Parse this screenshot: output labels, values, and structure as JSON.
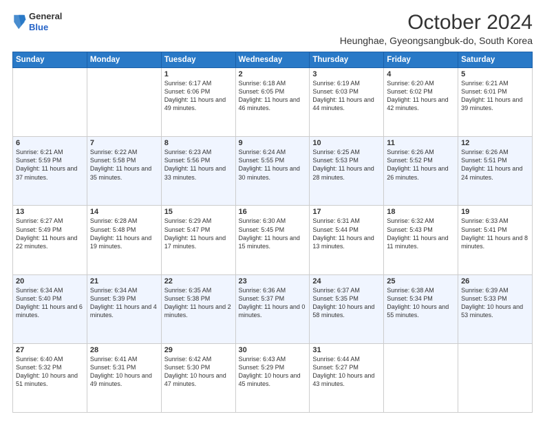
{
  "header": {
    "logo": {
      "line1": "General",
      "line2": "Blue"
    },
    "month": "October 2024",
    "location": "Heunghae, Gyeongsangbuk-do, South Korea"
  },
  "days_of_week": [
    "Sunday",
    "Monday",
    "Tuesday",
    "Wednesday",
    "Thursday",
    "Friday",
    "Saturday"
  ],
  "weeks": [
    [
      {
        "day": "",
        "info": ""
      },
      {
        "day": "",
        "info": ""
      },
      {
        "day": "1",
        "info": "Sunrise: 6:17 AM\nSunset: 6:06 PM\nDaylight: 11 hours and 49 minutes."
      },
      {
        "day": "2",
        "info": "Sunrise: 6:18 AM\nSunset: 6:05 PM\nDaylight: 11 hours and 46 minutes."
      },
      {
        "day": "3",
        "info": "Sunrise: 6:19 AM\nSunset: 6:03 PM\nDaylight: 11 hours and 44 minutes."
      },
      {
        "day": "4",
        "info": "Sunrise: 6:20 AM\nSunset: 6:02 PM\nDaylight: 11 hours and 42 minutes."
      },
      {
        "day": "5",
        "info": "Sunrise: 6:21 AM\nSunset: 6:01 PM\nDaylight: 11 hours and 39 minutes."
      }
    ],
    [
      {
        "day": "6",
        "info": "Sunrise: 6:21 AM\nSunset: 5:59 PM\nDaylight: 11 hours and 37 minutes."
      },
      {
        "day": "7",
        "info": "Sunrise: 6:22 AM\nSunset: 5:58 PM\nDaylight: 11 hours and 35 minutes."
      },
      {
        "day": "8",
        "info": "Sunrise: 6:23 AM\nSunset: 5:56 PM\nDaylight: 11 hours and 33 minutes."
      },
      {
        "day": "9",
        "info": "Sunrise: 6:24 AM\nSunset: 5:55 PM\nDaylight: 11 hours and 30 minutes."
      },
      {
        "day": "10",
        "info": "Sunrise: 6:25 AM\nSunset: 5:53 PM\nDaylight: 11 hours and 28 minutes."
      },
      {
        "day": "11",
        "info": "Sunrise: 6:26 AM\nSunset: 5:52 PM\nDaylight: 11 hours and 26 minutes."
      },
      {
        "day": "12",
        "info": "Sunrise: 6:26 AM\nSunset: 5:51 PM\nDaylight: 11 hours and 24 minutes."
      }
    ],
    [
      {
        "day": "13",
        "info": "Sunrise: 6:27 AM\nSunset: 5:49 PM\nDaylight: 11 hours and 22 minutes."
      },
      {
        "day": "14",
        "info": "Sunrise: 6:28 AM\nSunset: 5:48 PM\nDaylight: 11 hours and 19 minutes."
      },
      {
        "day": "15",
        "info": "Sunrise: 6:29 AM\nSunset: 5:47 PM\nDaylight: 11 hours and 17 minutes."
      },
      {
        "day": "16",
        "info": "Sunrise: 6:30 AM\nSunset: 5:45 PM\nDaylight: 11 hours and 15 minutes."
      },
      {
        "day": "17",
        "info": "Sunrise: 6:31 AM\nSunset: 5:44 PM\nDaylight: 11 hours and 13 minutes."
      },
      {
        "day": "18",
        "info": "Sunrise: 6:32 AM\nSunset: 5:43 PM\nDaylight: 11 hours and 11 minutes."
      },
      {
        "day": "19",
        "info": "Sunrise: 6:33 AM\nSunset: 5:41 PM\nDaylight: 11 hours and 8 minutes."
      }
    ],
    [
      {
        "day": "20",
        "info": "Sunrise: 6:34 AM\nSunset: 5:40 PM\nDaylight: 11 hours and 6 minutes."
      },
      {
        "day": "21",
        "info": "Sunrise: 6:34 AM\nSunset: 5:39 PM\nDaylight: 11 hours and 4 minutes."
      },
      {
        "day": "22",
        "info": "Sunrise: 6:35 AM\nSunset: 5:38 PM\nDaylight: 11 hours and 2 minutes."
      },
      {
        "day": "23",
        "info": "Sunrise: 6:36 AM\nSunset: 5:37 PM\nDaylight: 11 hours and 0 minutes."
      },
      {
        "day": "24",
        "info": "Sunrise: 6:37 AM\nSunset: 5:35 PM\nDaylight: 10 hours and 58 minutes."
      },
      {
        "day": "25",
        "info": "Sunrise: 6:38 AM\nSunset: 5:34 PM\nDaylight: 10 hours and 55 minutes."
      },
      {
        "day": "26",
        "info": "Sunrise: 6:39 AM\nSunset: 5:33 PM\nDaylight: 10 hours and 53 minutes."
      }
    ],
    [
      {
        "day": "27",
        "info": "Sunrise: 6:40 AM\nSunset: 5:32 PM\nDaylight: 10 hours and 51 minutes."
      },
      {
        "day": "28",
        "info": "Sunrise: 6:41 AM\nSunset: 5:31 PM\nDaylight: 10 hours and 49 minutes."
      },
      {
        "day": "29",
        "info": "Sunrise: 6:42 AM\nSunset: 5:30 PM\nDaylight: 10 hours and 47 minutes."
      },
      {
        "day": "30",
        "info": "Sunrise: 6:43 AM\nSunset: 5:29 PM\nDaylight: 10 hours and 45 minutes."
      },
      {
        "day": "31",
        "info": "Sunrise: 6:44 AM\nSunset: 5:27 PM\nDaylight: 10 hours and 43 minutes."
      },
      {
        "day": "",
        "info": ""
      },
      {
        "day": "",
        "info": ""
      }
    ]
  ]
}
